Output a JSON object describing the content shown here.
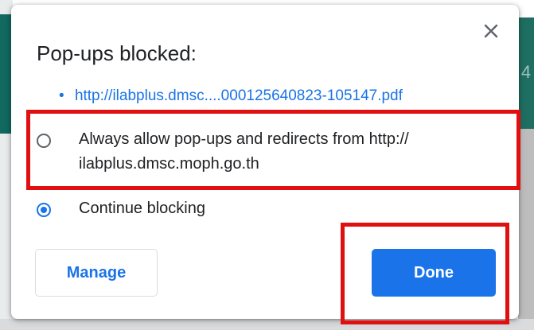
{
  "popup": {
    "title": "Pop-ups blocked:",
    "close_icon": "close-icon",
    "blocked_link": "http://ilabplus.dmsc....000125640823-105147.pdf",
    "link_bullet": "•",
    "options": {
      "allow": {
        "label": "Always allow pop-ups and redirects from http:// ilabplus.dmsc.moph.go.th",
        "selected": false
      },
      "block": {
        "label": "Continue blocking",
        "selected": true
      }
    },
    "manage_label": "Manage",
    "done_label": "Done"
  },
  "backdrop": {
    "peek_text": "4"
  },
  "colors": {
    "accent": "#1a73e8",
    "highlight": "#e01010",
    "teal": "#11695f"
  }
}
